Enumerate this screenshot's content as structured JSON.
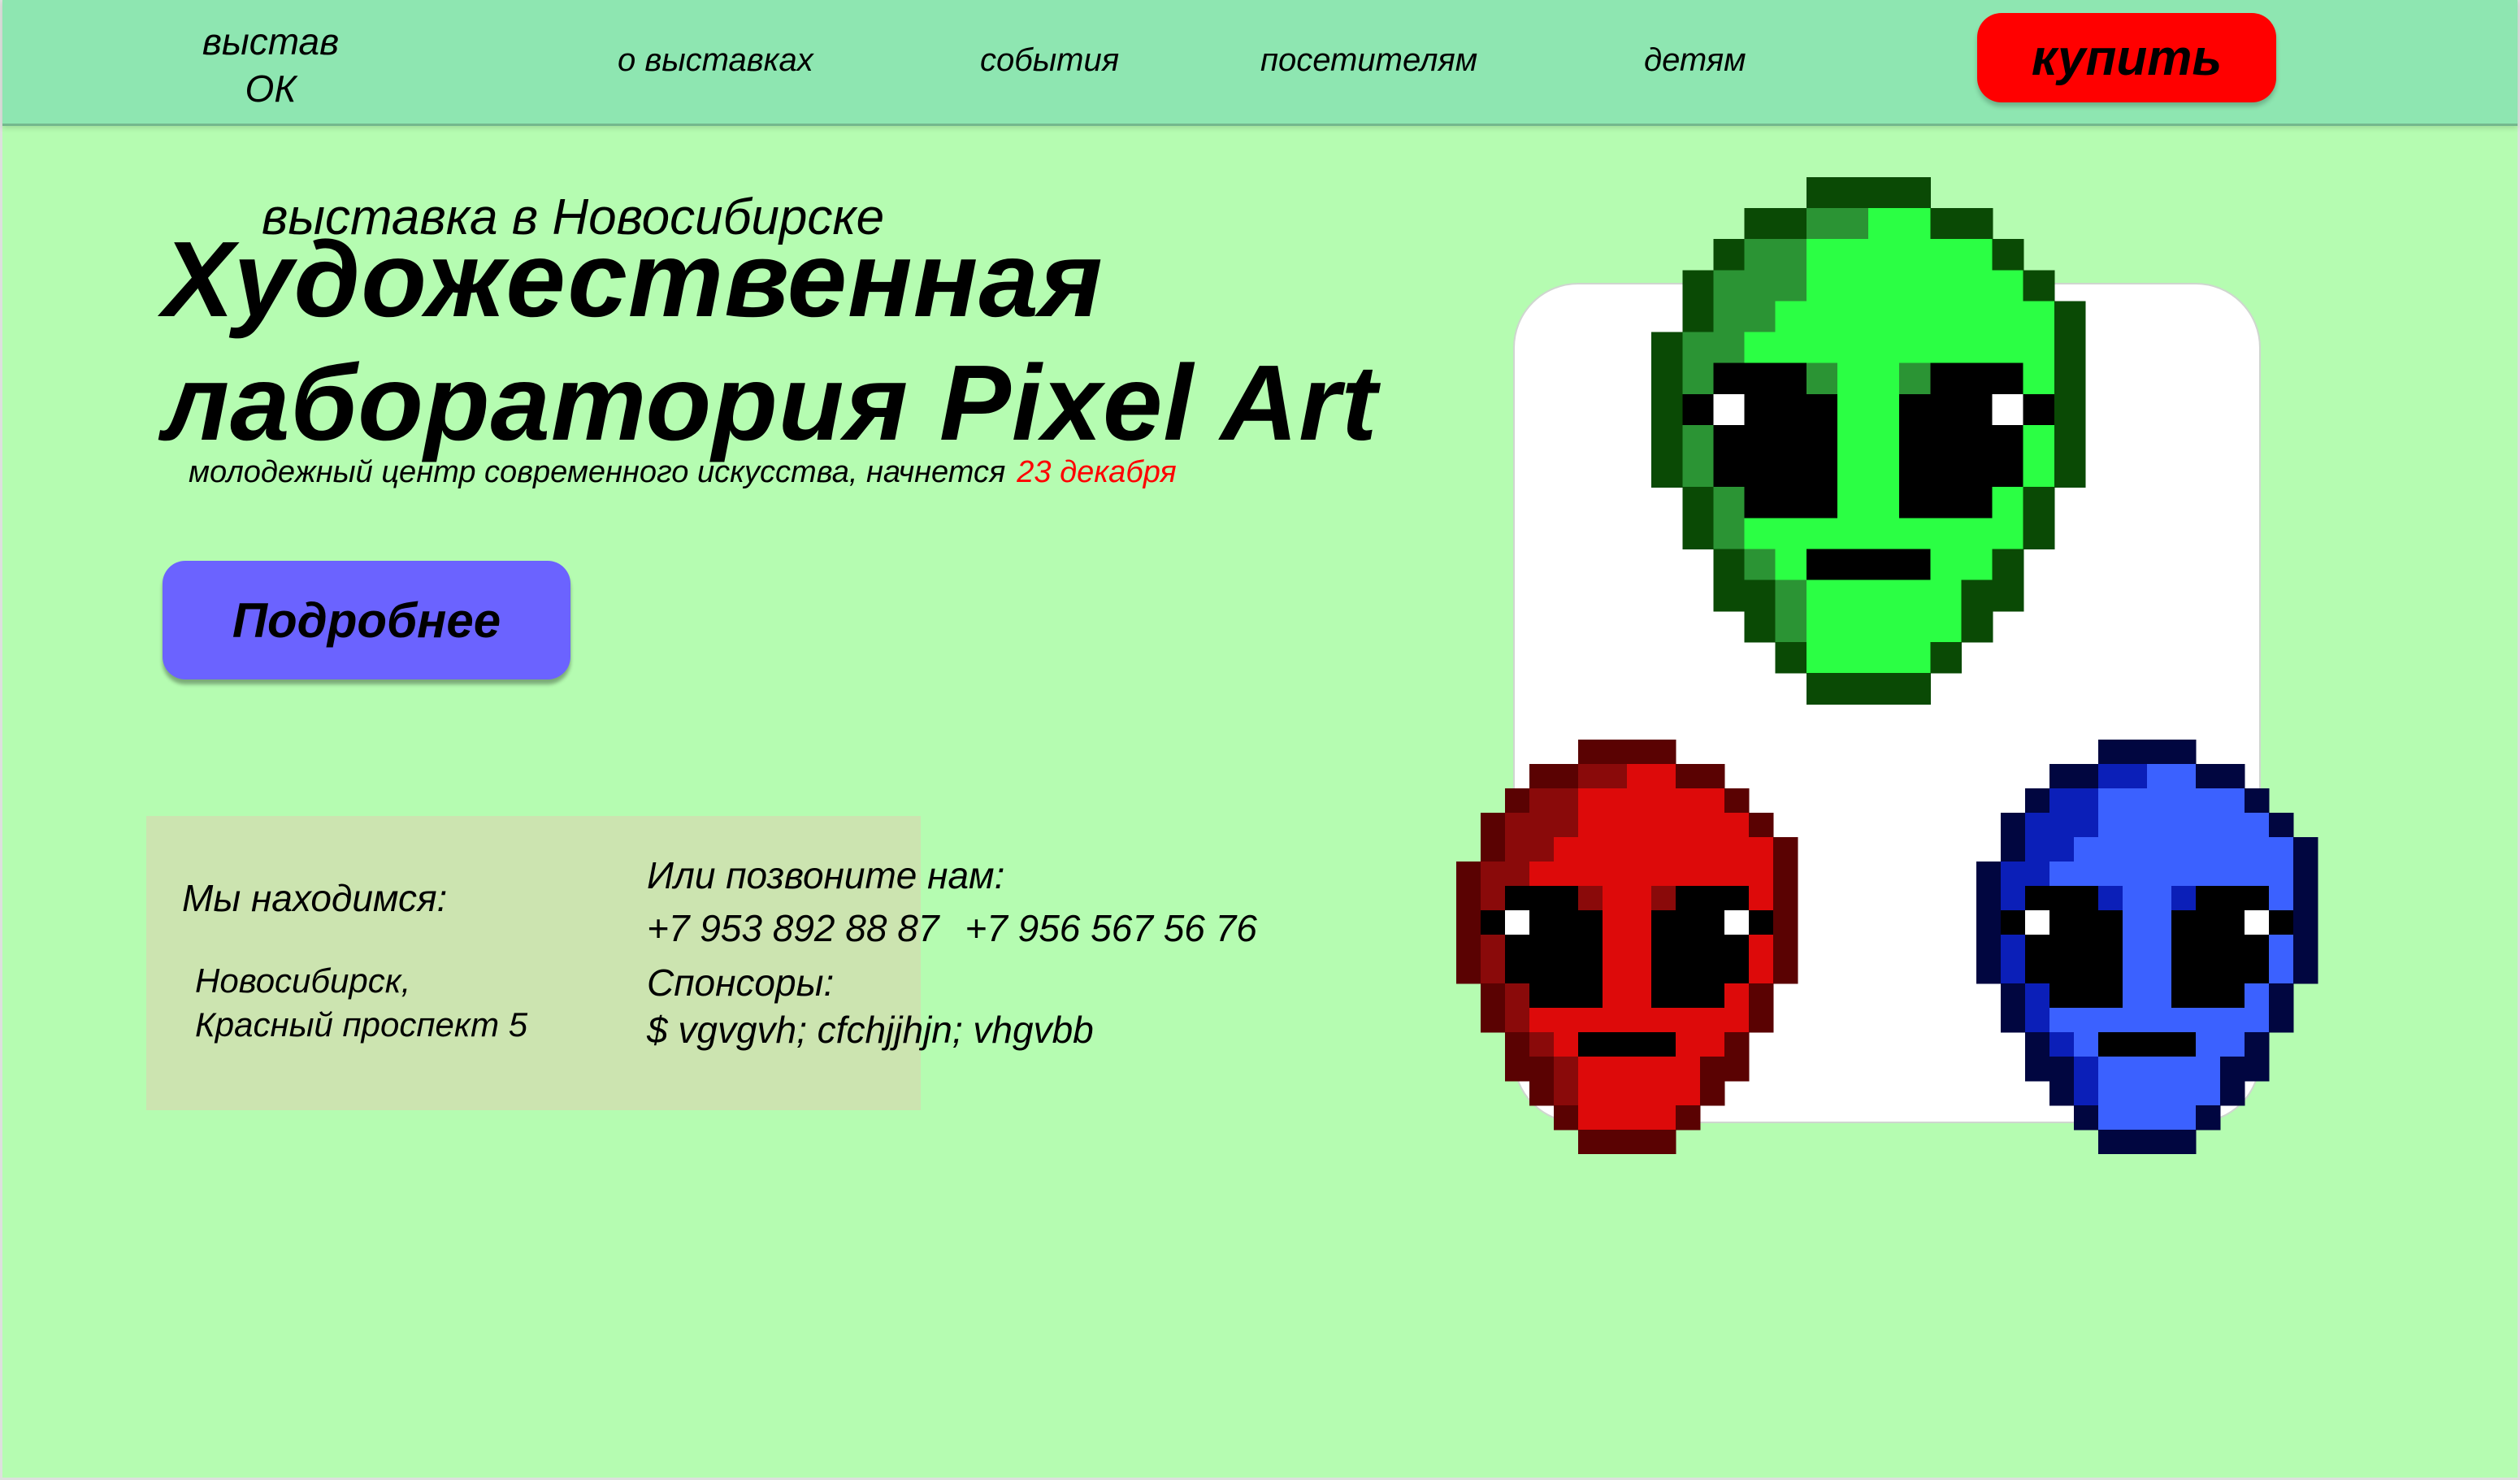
{
  "header": {
    "logo": "выстав\nОК",
    "nav": [
      "о выставках",
      "события",
      "посетителям",
      "детям"
    ],
    "buy_label": "купить"
  },
  "hero": {
    "subtitle": "выставка в Новосибирске",
    "title_line1": "Художественная",
    "title_line2": "лаборатория Pixel Art",
    "description": "молодежный центр современного искусства, начнется",
    "date": "23 декабря",
    "more_label": "Подробнее"
  },
  "contact": {
    "location_label": "Мы находимся:",
    "address_line1": "Новосибирск,",
    "address_line2": "Красный проспект 5",
    "call_label": "Или  позвоните нам:",
    "phones": [
      "+7 953 892 88 87",
      "+7 956 567 56 76"
    ],
    "sponsors_label": "Спонсоры:",
    "sponsors": "$ vgvgvh; cfchjjhjn; vhgvbb"
  },
  "colors": {
    "background": "#b5fcb1",
    "header": "#8ee6b1",
    "buy_button": "#ff0000",
    "more_button": "#6b63ff",
    "date_text": "#ff0000",
    "contact_panel": "#cce4b0"
  },
  "artwork": [
    {
      "name": "green-alien",
      "colors": {
        "outline": "#0a4a05",
        "mid": "#2b9434",
        "light": "#2bff44",
        "eye": "#000000",
        "white": "#ffffff"
      }
    },
    {
      "name": "red-alien",
      "colors": {
        "outline": "#5a0202",
        "mid": "#8a0a0a",
        "light": "#dd0a0a",
        "eye": "#000000",
        "white": "#ffffff"
      }
    },
    {
      "name": "blue-alien",
      "colors": {
        "outline": "#010640",
        "mid": "#0b1fb8",
        "light": "#3b61ff",
        "eye": "#000000",
        "white": "#ffffff"
      }
    }
  ]
}
